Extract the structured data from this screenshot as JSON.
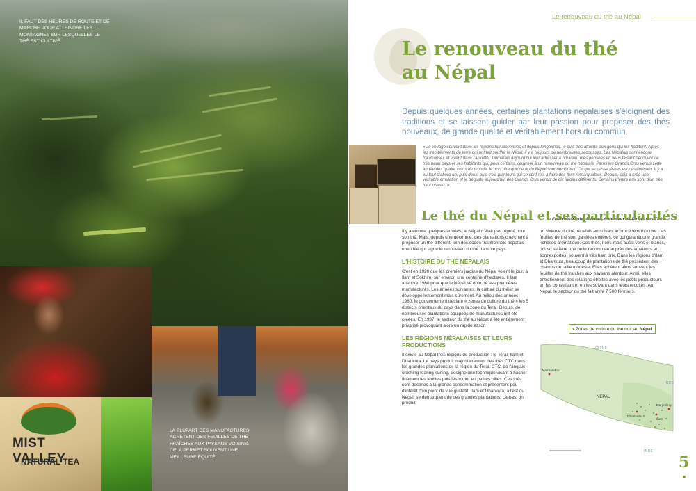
{
  "left_page": {
    "caption_top": "IL FAUT DES HEURES DE ROUTE ET DE MARCHE POUR ATTEINDRE LES MONTAGNES SUR LESQUELLES LE THÉ EST CULTIVÉ.",
    "caption_bottom": "LA PLUPART DES MANUFACTURES ACHÈTENT DES FEUILLES DE THÉ FRAÎCHES AUX PAYSANS VOISINS. CELA PERMET SOUVENT UNE MEILLEURE ÉQUITÉ.",
    "sack_brand": "MIST VALLEY",
    "sack_subtitle": "NATURAL TEA"
  },
  "right_page": {
    "running_head": "Le renouveau du thé au Népal",
    "title_line1": "Le renouveau du thé",
    "title_line2": "au Népal",
    "intro": "Depuis quelques années, certaines plantations népalaises s'éloignent des traditions et se laissent guider par leur passion pour proposer des thés nouveaux, de grande qualité et véritablement hors du commun.",
    "quote": "« Je voyage souvent dans les régions himalayennes et depuis longtemps, je suis très attaché aux gens qui les habitent. Après les tremblements de terre qui ont fait souffrir le Népal, il y a toujours de nombreuses secousses. Les Népalais sont encore traumatisés et vivent dans l'anxiété. J'aimerais aujourd'hui leur adresser à nouveau mes pensées en vous faisant découvrir ce très beau pays et ses habitants qui, pour certains, œuvrent à un renouveau du thé népalais. Parmi les Grands Crus venus cette année des quatre coins du monde, je dois dire que ceux du Népal sont nombreux. Ce qui se passe là-bas est passionnant. Il y a eu tout d'abord un, puis deux, puis trois planteurs qui se sont mis à faire des thés remarquables. Depuis, cela a créé une véritable émulation et je déguste aujourd'hui des Grands Crus venus de dix jardins différents. Certains d'entre eux sont d'un très haut niveau. »",
    "quote_author": "François-Xavier Delmas, fondateur de Palais des Thés",
    "section_title": "Le thé du Népal et ses particularités",
    "col1_intro": "Il y a encore quelques années, le Népal n'était pas réputé pour son thé. Mais, depuis une décennie, des plantations cherchent à proposer un thé différent, loin des codes traditionnels népalais : une idée qui signe le renouveau du thé dans ce pays.",
    "h_histoire": "L'HISTOIRE DU THÉ NÉPALAIS",
    "p_histoire": "C'est en 1920 que les premiers jardins du Népal voient le jour, à Ilam et Sokhim, sur environ une centaine d'hectares. Il faut attendre 1960 pour que le Népal se dote de ses premières manufactures. Les années suivantes, la culture du théier se développe lentement mais sûrement. Au milieu des années 1980, le gouvernement déclare « zones de culture du thé » les 5 districts orientaux du pays dans la zone du Terai. Depuis, de nombreuses plantations équipées de manufactures ont été créées. En 1997, le secteur du thé au Népal a été entièrement privatisé provoquant alors un rapide essor.",
    "h_regions": "LES RÉGIONS NÉPALAISES ET LEURS PRODUCTIONS",
    "p_regions": "Il existe au Népal trois régions de production : le Terai, Ilam et Dhankuta. Le pays produit majoritairement des thés CTC dans les grandes plantations de la région du Terai. CTC, de l'anglais crushing-tearing-curling, désigne une technique visant à hacher finement les feuilles puis les rouler en petites billes. Ces thés sont destinés à la grande consommation et présentent peu d'intérêt d'un point de vue gustatif. Ilam et Dhankuta, à l'est du Népal, se démarquent de ces grandes plantations. Là-bas, on produit",
    "col2_text": "un sixième du thé népalais en suivant le procédé orthodoxe : les feuilles de thé sont gardées entières, ce qui garantit une grande richesse aromatique. Ces thés, noirs mais aussi verts et blancs, ont su se faire une belle renommée auprès des amateurs et sont exportés, souvent à très haut prix. Dans les régions d'Ilam et Dhankuta, beaucoup de plantations de thé possèdent des champs de taille modeste. Elles achètent alors souvent les feuilles de thé fraîches aux paysans alentour. Ainsi, elles entretiennent des relations étroites avec les petits producteurs en les conseillant et en les suivant dans leurs récoltes. Au Népal, le secteur du thé fait vivre 7 500 fermiers.",
    "map_label_prefix": "Zones de culture du thé noir au",
    "map_label_strong": "Népal",
    "map_places": {
      "chine": "CHINE",
      "inde_east": "INDE",
      "inde_south": "INDE",
      "kathmandou": "Katmandou",
      "nepal": "NÉPAL",
      "dhankuta": "Dhankuta",
      "ilam": "Ilam",
      "darjeeling": "Darjeeling"
    },
    "page_number": "5"
  }
}
